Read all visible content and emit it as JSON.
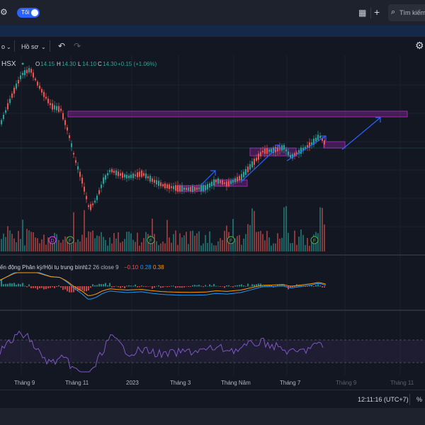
{
  "header": {
    "theme_toggle_label": "Tối",
    "search_placeholder": "Tìm kiếm"
  },
  "toolbar": {
    "profile_label": "Hồ sơ",
    "partial_left_label": "o"
  },
  "legend": {
    "symbol": "HSX",
    "open_label": "O",
    "open": "14.15",
    "high_label": "H",
    "high": "14.30",
    "low_label": "L",
    "low": "14.10",
    "close_label": "C",
    "close": "14.30",
    "change": "+0.15 (+1.06%)"
  },
  "macd_legend": {
    "title": "ến động Phân kỳ/Hội tụ trung bình",
    "params": "12 26 close 9",
    "v1": "−0.10",
    "v2": "0.28",
    "v3": "0.38"
  },
  "time_axis": {
    "labels": [
      "Tháng 9",
      "Tháng 11",
      "2023",
      "Tháng 3",
      "Tháng Năm",
      "Tháng 7",
      "Tháng 9",
      "Tháng 11"
    ]
  },
  "events": [
    "D",
    "F",
    "F",
    "F",
    "F"
  ],
  "status": {
    "clock": "12:11:16 (UTC+7)",
    "percent_label": "%"
  },
  "colors": {
    "up": "#26a69a",
    "down": "#ef5350",
    "macd_line": "#2196f3",
    "signal_line": "#ff9800",
    "rsi_line": "#7e57c2",
    "zone": "#9c27b0",
    "arrow": "#2962ff"
  },
  "icons": {
    "settings": "gear-icon",
    "layout": "grid-icon",
    "add": "plus-icon",
    "search": "search-icon",
    "undo": "undo-icon",
    "redo": "redo-icon",
    "chart_settings": "gear-icon"
  }
}
